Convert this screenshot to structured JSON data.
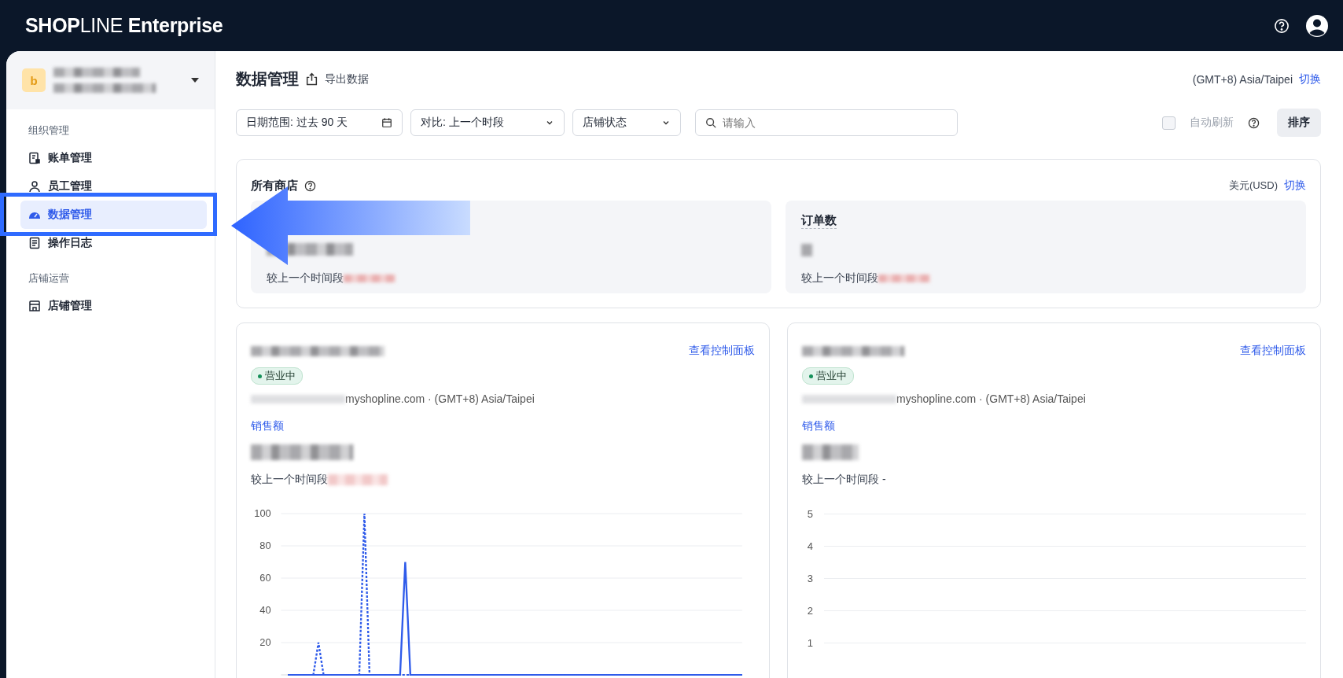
{
  "header": {
    "logo": "**SHOP**LINE **Enterprise**"
  },
  "sidebar": {
    "account": {
      "avatar": "b"
    },
    "sections": [
      {
        "heading": "组织管理",
        "items": [
          {
            "label": "账单管理",
            "selected": false
          },
          {
            "label": "员工管理",
            "selected": false
          },
          {
            "label": "数据管理",
            "selected": true
          },
          {
            "label": "操作日志",
            "selected": false
          }
        ]
      },
      {
        "heading": "店铺运营",
        "items": [
          {
            "label": "店铺管理",
            "selected": false
          }
        ]
      }
    ]
  },
  "page": {
    "title": "数据管理",
    "export": "导出数据",
    "timezone": "(GMT+8) Asia/Taipei",
    "switch": "切换"
  },
  "filters": [
    {
      "kind": "date",
      "label": "日期范围: 过去 90 天"
    },
    {
      "kind": "select",
      "label": "对比: 上一个时段"
    },
    {
      "kind": "select",
      "label": "店铺状态"
    }
  ],
  "search": {
    "placeholder": "请输入"
  },
  "auto_refresh": {
    "label": "自动刷新",
    "checked": false
  },
  "sort_button": "排序",
  "summary": {
    "title": "所有商店",
    "currency": "美元(USD)",
    "switch": "切换",
    "metrics": [
      {
        "compare": "较上一个时间段"
      },
      {
        "title": "订单数",
        "compare": "较上一个时间段"
      }
    ]
  },
  "stores": [
    {
      "status": "营业中",
      "domain": "myshopline.com · (GMT+8) Asia/Taipei",
      "link": "查看控制面板",
      "metric": "销售额",
      "compare": "较上一个时间段",
      "chart_data": {
        "type": "line",
        "grid": true,
        "ylim": [
          0,
          100
        ],
        "yticks": [
          20,
          40,
          60,
          80,
          100
        ],
        "series": [
          {
            "color": "#2f5bea",
            "line_style": "solid",
            "values": [
              0,
              0,
              0,
              0,
              0,
              0,
              0,
              0,
              0,
              0,
              0,
              0,
              0,
              0,
              0,
              0,
              0,
              0,
              0,
              0,
              0,
              0,
              0,
              70,
              0,
              0,
              0,
              0,
              0,
              0,
              0,
              0,
              0,
              0,
              0,
              0,
              0,
              0,
              0,
              0,
              0,
              0,
              0,
              0,
              0,
              0,
              0,
              0,
              0,
              0,
              0,
              0,
              0,
              0,
              0,
              0,
              0,
              0,
              0,
              0,
              0,
              0,
              0,
              0,
              0,
              0,
              0,
              0,
              0,
              0,
              0,
              0,
              0,
              0,
              0,
              0,
              0,
              0,
              0,
              0,
              0,
              0,
              0,
              0,
              0,
              0,
              0,
              0,
              0,
              0
            ]
          },
          {
            "color": "#2f5bea",
            "line_style": "dotted",
            "values": [
              0,
              0,
              0,
              0,
              0,
              0,
              20,
              0,
              0,
              0,
              0,
              0,
              0,
              0,
              0,
              100,
              0,
              0,
              0,
              0,
              0,
              0,
              0,
              0,
              0,
              0,
              0,
              0,
              0,
              0,
              0,
              0,
              0,
              0,
              0,
              0,
              0,
              0,
              0,
              0,
              0,
              0,
              0,
              0,
              0,
              0,
              0,
              0,
              0,
              0,
              0,
              0,
              0,
              0,
              0,
              0,
              0,
              0,
              0,
              0,
              0,
              0,
              0,
              0,
              0,
              0,
              0,
              0,
              0,
              0,
              0,
              0,
              0,
              0,
              0,
              0,
              0,
              0,
              0,
              0,
              0,
              0,
              0,
              0,
              0,
              0,
              0,
              0,
              0,
              0
            ]
          }
        ]
      }
    },
    {
      "status": "营业中",
      "domain": "myshopline.com · (GMT+8) Asia/Taipei",
      "link": "查看控制面板",
      "metric": "销售额",
      "compare": "较上一个时间段 -",
      "axis_labels": [
        "5",
        "4",
        "3",
        "2",
        "1"
      ]
    }
  ],
  "annotations": {
    "highlight_box": true,
    "arrow": true
  }
}
